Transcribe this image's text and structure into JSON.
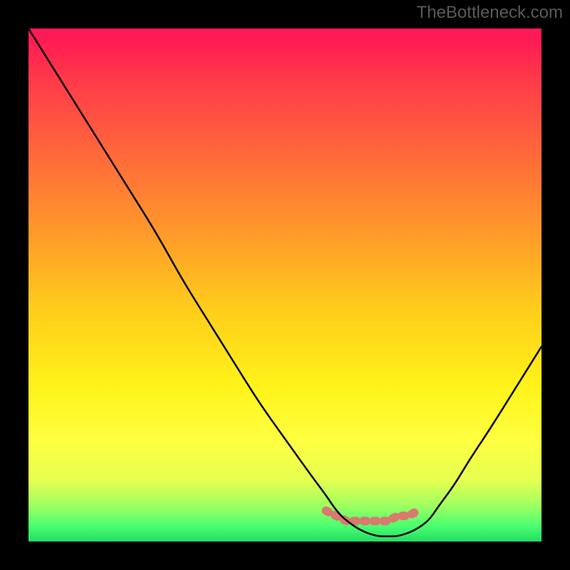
{
  "watermark": "TheBottleneck.com",
  "chart_data": {
    "type": "line",
    "title": "",
    "xlabel": "",
    "ylabel": "",
    "xlim": [
      0,
      100
    ],
    "ylim": [
      0,
      100
    ],
    "series": [
      {
        "name": "bottleneck-curve",
        "x": [
          0,
          5,
          10,
          15,
          20,
          25,
          30,
          35,
          40,
          45,
          50,
          55,
          58,
          60,
          62,
          65,
          68,
          70,
          72,
          75,
          78,
          80,
          83,
          86,
          90,
          95,
          100
        ],
        "y": [
          100,
          92,
          84,
          76,
          68,
          60,
          51,
          43,
          35,
          27,
          20,
          13,
          9,
          6,
          4,
          2,
          1,
          1,
          1,
          2,
          4,
          7,
          11,
          16,
          22,
          30,
          38
        ]
      },
      {
        "name": "sweet-spot-band",
        "x": [
          58,
          60,
          62,
          64,
          66,
          68,
          70,
          72,
          74,
          76
        ],
        "y": [
          6,
          5,
          4,
          4,
          4,
          4,
          4,
          5,
          5,
          6
        ]
      }
    ],
    "gradient_stops": [
      {
        "pos": 0,
        "color": "#ff1a55"
      },
      {
        "pos": 25,
        "color": "#ff6a3a"
      },
      {
        "pos": 55,
        "color": "#ffce1a"
      },
      {
        "pos": 80,
        "color": "#ffff40"
      },
      {
        "pos": 100,
        "color": "#24dd62"
      }
    ],
    "sweet_spot_color": "#d87a6e"
  }
}
